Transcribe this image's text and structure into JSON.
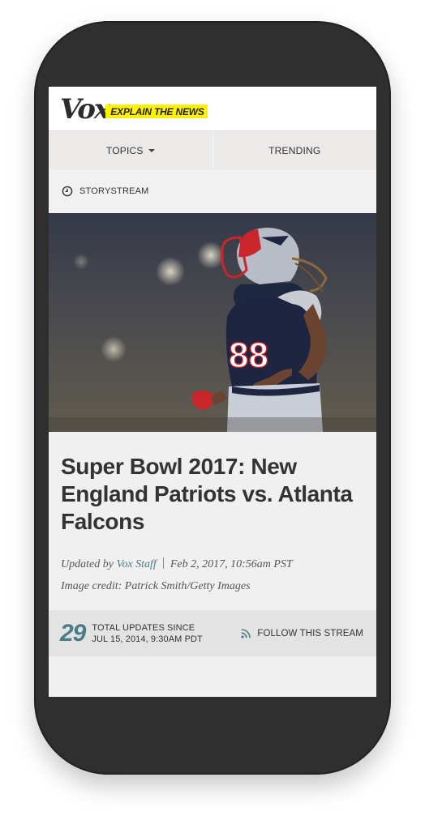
{
  "header": {
    "logo_text": "Vox",
    "tagline": "EXPLAIN THE NEWS",
    "tagline_color": "#fff200"
  },
  "nav": {
    "topics_label": "TOPICS",
    "trending_label": "TRENDING"
  },
  "storystream": {
    "icon": "clock-icon",
    "label": "STORYSTREAM"
  },
  "hero": {
    "jersey_number": "88"
  },
  "article": {
    "title": "Super Bowl 2017: New England Patriots vs. Atlanta Falcons",
    "updated_prefix": "Updated by",
    "author": "Vox Staff",
    "date": "Feb 2, 2017, 10:56am PST",
    "image_credit": "Image credit: Patrick Smith/Getty Images",
    "accent_color": "#4b7c8a"
  },
  "updates": {
    "count": "29",
    "line1": "TOTAL UPDATES SINCE",
    "line2": "JUL 15, 2014, 9:30AM PDT",
    "follow_icon": "rss-icon",
    "follow_label": "FOLLOW THIS STREAM"
  }
}
